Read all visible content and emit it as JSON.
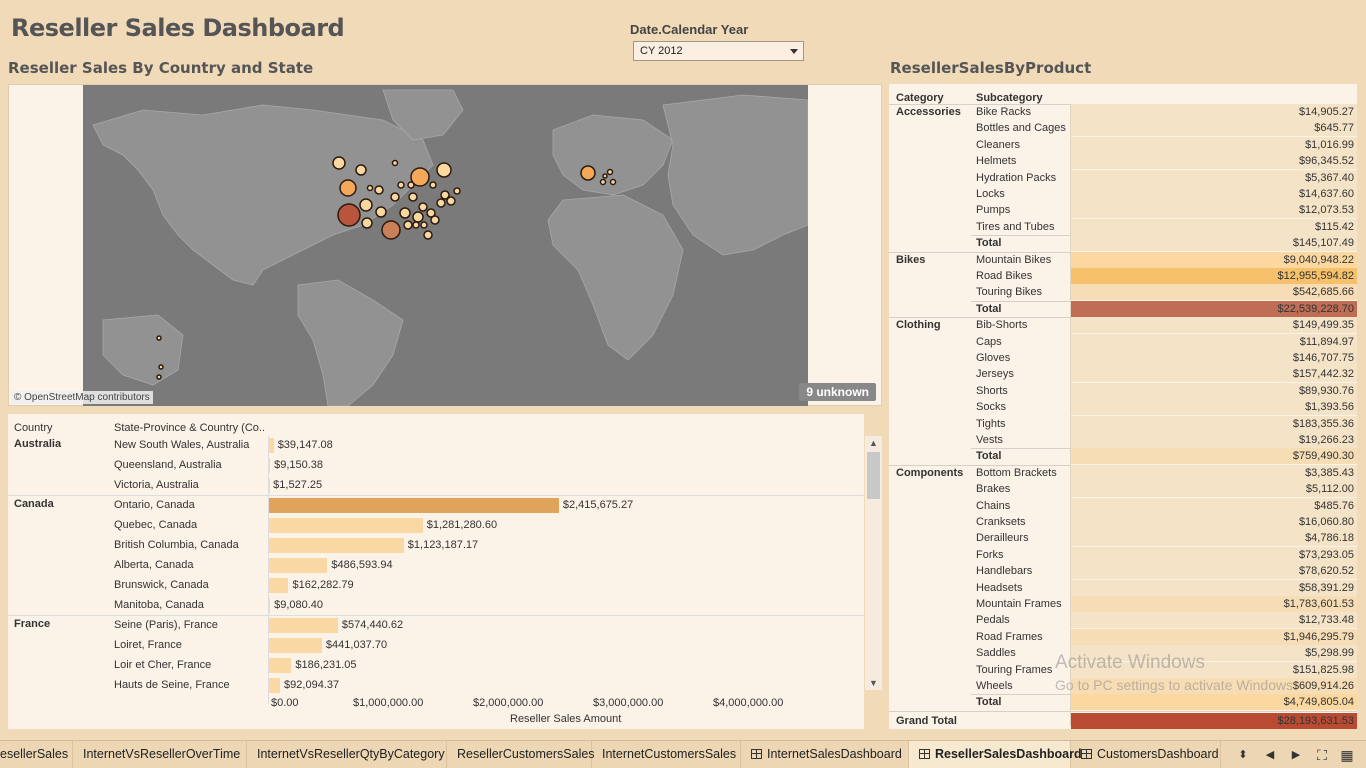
{
  "dashboard": {
    "title": "Reseller Sales Dashboard"
  },
  "filter": {
    "label": "Date.Calendar Year",
    "selected": "CY 2012"
  },
  "map": {
    "title": "Reseller Sales By Country and State",
    "credit": "© OpenStreetMap contributors",
    "unknown": "9 unknown",
    "colors": {
      "ocean": "#7a7a7a",
      "land": "#929292",
      "border": "#a8a8a8"
    }
  },
  "state_table": {
    "col_country": "Country",
    "col_state": "State-Province & Country (Co..",
    "axis_title": "Reseller Sales Amount",
    "axis_ticks": [
      "$0.00",
      "$1,000,000.00",
      "$2,000,000.00",
      "$3,000,000.00",
      "$4,000,000.00"
    ],
    "rows": [
      {
        "country": "Australia",
        "state": "New South Wales, Australia",
        "value": 39147.08,
        "label": "$39,147.08"
      },
      {
        "country": "",
        "state": "Queensland, Australia",
        "value": 9150.38,
        "label": "$9,150.38"
      },
      {
        "country": "",
        "state": "Victoria, Australia",
        "value": 1527.25,
        "label": "$1,527.25"
      },
      {
        "country": "Canada",
        "state": "Ontario, Canada",
        "value": 2415675.27,
        "label": "$2,415,675.27"
      },
      {
        "country": "",
        "state": "Quebec, Canada",
        "value": 1281280.6,
        "label": "$1,281,280.60"
      },
      {
        "country": "",
        "state": "British Columbia, Canada",
        "value": 1123187.17,
        "label": "$1,123,187.17"
      },
      {
        "country": "",
        "state": "Alberta, Canada",
        "value": 486593.94,
        "label": "$486,593.94"
      },
      {
        "country": "",
        "state": "Brunswick, Canada",
        "value": 162282.79,
        "label": "$162,282.79"
      },
      {
        "country": "",
        "state": "Manitoba, Canada",
        "value": 9080.4,
        "label": "$9,080.40"
      },
      {
        "country": "France",
        "state": "Seine (Paris), France",
        "value": 574440.62,
        "label": "$574,440.62"
      },
      {
        "country": "",
        "state": "Loiret, France",
        "value": 441037.7,
        "label": "$441,037.70"
      },
      {
        "country": "",
        "state": "Loir et Cher, France",
        "value": 186231.05,
        "label": "$186,231.05"
      },
      {
        "country": "",
        "state": "Hauts de Seine, France",
        "value": 92094.37,
        "label": "$92,094.37"
      }
    ]
  },
  "product_table": {
    "title": "ResellerSalesByProduct",
    "col_category": "Category",
    "col_subcategory": "Subcategory",
    "groups": [
      {
        "category": "Accessories",
        "items": [
          {
            "sub": "Bike Racks",
            "value": "$14,905.27",
            "heat": 0
          },
          {
            "sub": "Bottles and Cages",
            "value": "$645.77",
            "heat": 0
          },
          {
            "sub": "Cleaners",
            "value": "$1,016.99",
            "heat": 0
          },
          {
            "sub": "Helmets",
            "value": "$96,345.52",
            "heat": 0
          },
          {
            "sub": "Hydration Packs",
            "value": "$5,367.40",
            "heat": 0
          },
          {
            "sub": "Locks",
            "value": "$14,637.60",
            "heat": 0
          },
          {
            "sub": "Pumps",
            "value": "$12,073.53",
            "heat": 0
          },
          {
            "sub": "Tires and Tubes",
            "value": "$115.42",
            "heat": 0
          },
          {
            "sub": "Total",
            "value": "$145,107.49",
            "heat": 0
          }
        ]
      },
      {
        "category": "Bikes",
        "items": [
          {
            "sub": "Mountain Bikes",
            "value": "$9,040,948.22",
            "heat": 2
          },
          {
            "sub": "Road Bikes",
            "value": "$12,955,594.82",
            "heat": 3
          },
          {
            "sub": "Touring Bikes",
            "value": "$542,685.66",
            "heat": 1
          },
          {
            "sub": "Total",
            "value": "$22,539,228.70",
            "heat": 4
          }
        ]
      },
      {
        "category": "Clothing",
        "items": [
          {
            "sub": "Bib-Shorts",
            "value": "$149,499.35",
            "heat": 0
          },
          {
            "sub": "Caps",
            "value": "$11,894.97",
            "heat": 0
          },
          {
            "sub": "Gloves",
            "value": "$146,707.75",
            "heat": 0
          },
          {
            "sub": "Jerseys",
            "value": "$157,442.32",
            "heat": 0
          },
          {
            "sub": "Shorts",
            "value": "$89,930.76",
            "heat": 0
          },
          {
            "sub": "Socks",
            "value": "$1,393.56",
            "heat": 0
          },
          {
            "sub": "Tights",
            "value": "$183,355.36",
            "heat": 0
          },
          {
            "sub": "Vests",
            "value": "$19,266.23",
            "heat": 0
          },
          {
            "sub": "Total",
            "value": "$759,490.30",
            "heat": 1
          }
        ]
      },
      {
        "category": "Components",
        "items": [
          {
            "sub": "Bottom Brackets",
            "value": "$3,385.43",
            "heat": 0
          },
          {
            "sub": "Brakes",
            "value": "$5,112.00",
            "heat": 0
          },
          {
            "sub": "Chains",
            "value": "$485.76",
            "heat": 0
          },
          {
            "sub": "Cranksets",
            "value": "$16,060.80",
            "heat": 0
          },
          {
            "sub": "Derailleurs",
            "value": "$4,786.18",
            "heat": 0
          },
          {
            "sub": "Forks",
            "value": "$73,293.05",
            "heat": 0
          },
          {
            "sub": "Handlebars",
            "value": "$78,620.52",
            "heat": 0
          },
          {
            "sub": "Headsets",
            "value": "$58,391.29",
            "heat": 0
          },
          {
            "sub": "Mountain Frames",
            "value": "$1,783,601.53",
            "heat": 1
          },
          {
            "sub": "Pedals",
            "value": "$12,733.48",
            "heat": 0
          },
          {
            "sub": "Road Frames",
            "value": "$1,946,295.79",
            "heat": 1
          },
          {
            "sub": "Saddles",
            "value": "$5,298.99",
            "heat": 0
          },
          {
            "sub": "Touring Frames",
            "value": "$151,825.98",
            "heat": 0
          },
          {
            "sub": "Wheels",
            "value": "$609,914.26",
            "heat": 1
          },
          {
            "sub": "Total",
            "value": "$4,749,805.04",
            "heat": 2
          }
        ]
      }
    ],
    "grand_total_label": "Grand Total",
    "grand_total_value": "$28,193,631.53",
    "heat_colors": [
      "#f5e3c8",
      "#f7ddb5",
      "#fad8a0",
      "#f6c16a",
      "#bf6e55",
      "#b94b32"
    ]
  },
  "watermark": {
    "line1": "Activate Windows",
    "line2": "Go to PC settings to activate Windows."
  },
  "tabs": [
    {
      "label": "esellerSales",
      "icon": false,
      "active": false
    },
    {
      "label": "InternetVsResellerOverTime",
      "icon": false,
      "active": false
    },
    {
      "label": "InternetVsResellerQtyByCategory",
      "icon": false,
      "active": false
    },
    {
      "label": "ResellerCustomersSales",
      "icon": false,
      "active": false
    },
    {
      "label": "InternetCustomersSales",
      "icon": false,
      "active": false
    },
    {
      "label": "InternetSalesDashboard",
      "icon": true,
      "active": false
    },
    {
      "label": "ResellerSalesDashboard",
      "icon": true,
      "active": true
    },
    {
      "label": "CustomersDashboard",
      "icon": true,
      "active": false
    }
  ],
  "nav_icons": {
    "menu": "⬍",
    "prev": "◀",
    "next": "▶",
    "fit": "⛶",
    "grid": "▦"
  }
}
